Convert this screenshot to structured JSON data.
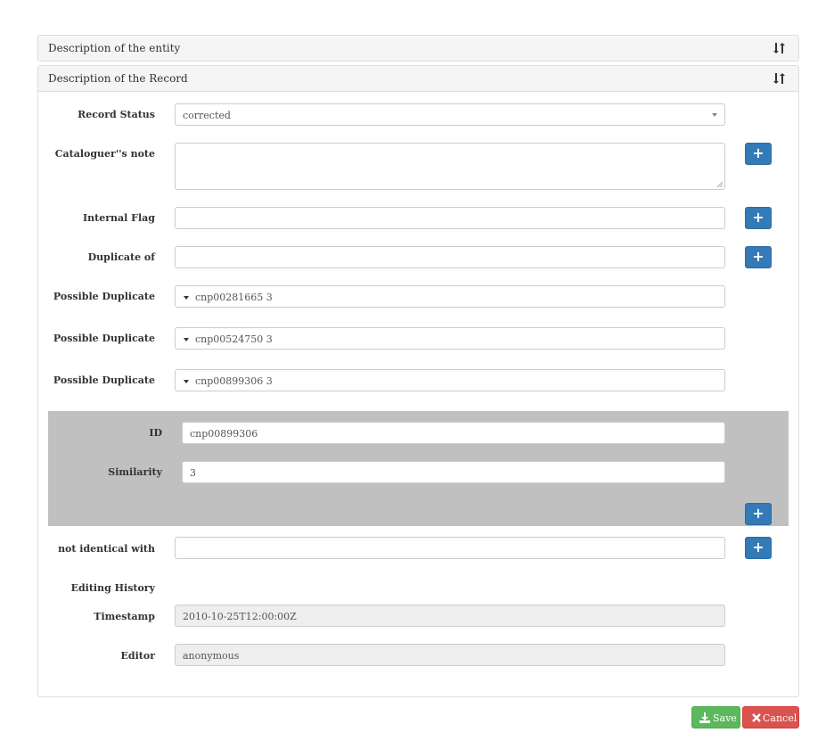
{
  "panels": {
    "entity": {
      "title": "Description of the entity",
      "toggle_icon": "sort-icon"
    },
    "record": {
      "title": "Description of the Record",
      "toggle_icon": "sort-icon"
    }
  },
  "form": {
    "record_status": {
      "label": "Record Status",
      "value": "corrected"
    },
    "cataloguer_note": {
      "label": "Cataloguer''s note",
      "value": ""
    },
    "internal_flag": {
      "label": "Internal Flag",
      "value": ""
    },
    "duplicate_of": {
      "label": "Duplicate of",
      "value": ""
    },
    "possible_duplicates": [
      {
        "label": "Possible Duplicate",
        "value": "cnp00281665 3"
      },
      {
        "label": "Possible Duplicate",
        "value": "cnp00524750 3"
      },
      {
        "label": "Possible Duplicate",
        "value": "cnp00899306 3"
      }
    ],
    "expanded_duplicate": {
      "id_label": "ID",
      "id_value": "cnp00899306",
      "similarity_label": "Similarity",
      "similarity_value": "3"
    },
    "not_identical_with": {
      "label": "not identical with",
      "value": ""
    },
    "editing_history": {
      "heading": "Editing History",
      "timestamp_label": "Timestamp",
      "timestamp_value": "2010-10-25T12:00:00Z",
      "editor_label": "Editor",
      "editor_value": "anonymous"
    },
    "add_button_icon": "plus-icon",
    "add_button_label": "+"
  },
  "actions": {
    "save": {
      "label": "Save",
      "icon": "download-icon"
    },
    "cancel": {
      "label": "Cancel",
      "icon": "times-icon"
    }
  },
  "colors": {
    "primary": "#337ab7",
    "success": "#5cb85c",
    "danger": "#d9534f",
    "expanded_bg": "#c0c0c0"
  }
}
